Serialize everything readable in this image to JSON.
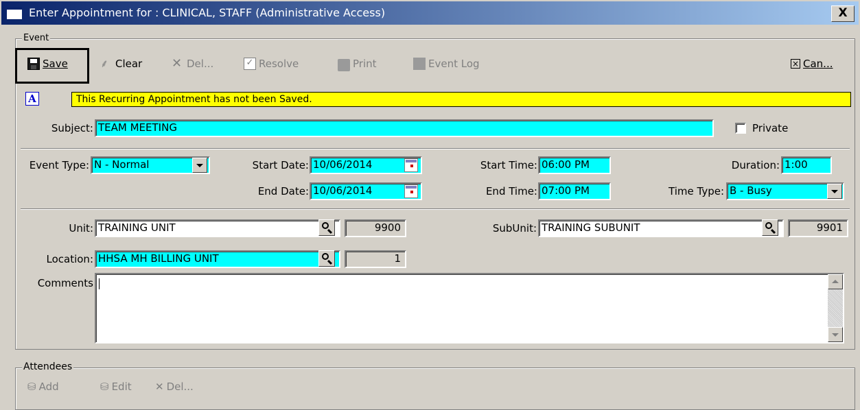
{
  "window": {
    "title": "Enter Appointment for : CLINICAL, STAFF (Administrative Access)",
    "close_label": "X"
  },
  "event_group": {
    "label": "Event"
  },
  "toolbar": {
    "save": "Save",
    "clear": "Clear",
    "del": "Del...",
    "resolve": "Resolve",
    "print": "Print",
    "event_log": "Event Log",
    "cancel": "Can..."
  },
  "banner": {
    "icon_letter": "A",
    "message": "This Recurring Appointment has not been Saved."
  },
  "subject": {
    "label": "Subject:",
    "value": "TEAM MEETING"
  },
  "private": {
    "label": "Private",
    "checked": false
  },
  "event_type": {
    "label": "Event Type:",
    "value": "N - Normal"
  },
  "start_date": {
    "label": "Start Date:",
    "value": "10/06/2014"
  },
  "end_date": {
    "label": "End Date:",
    "value": "10/06/2014"
  },
  "start_time": {
    "label": "Start Time:",
    "value": "06:00 PM"
  },
  "end_time": {
    "label": "End Time:",
    "value": "07:00 PM"
  },
  "duration": {
    "label": "Duration:",
    "value": "1:00"
  },
  "time_type": {
    "label": "Time Type:",
    "value": "B - Busy"
  },
  "unit": {
    "label": "Unit:",
    "value": "TRAINING UNIT",
    "code": "9900"
  },
  "subunit": {
    "label": "SubUnit:",
    "value": "TRAINING SUBUNIT",
    "code": "9901"
  },
  "location": {
    "label": "Location:",
    "value": "HHSA MH BILLING UNIT",
    "code": "1"
  },
  "comments": {
    "label": "Comments",
    "value": ""
  },
  "attendees": {
    "label": "Attendees",
    "add": "Add",
    "edit": "Edit",
    "del": "Del..."
  },
  "colors": {
    "required_field": "#00ffff",
    "banner": "#ffff00",
    "titlebar_start": "#0a246a",
    "titlebar_end": "#a6caf0"
  }
}
